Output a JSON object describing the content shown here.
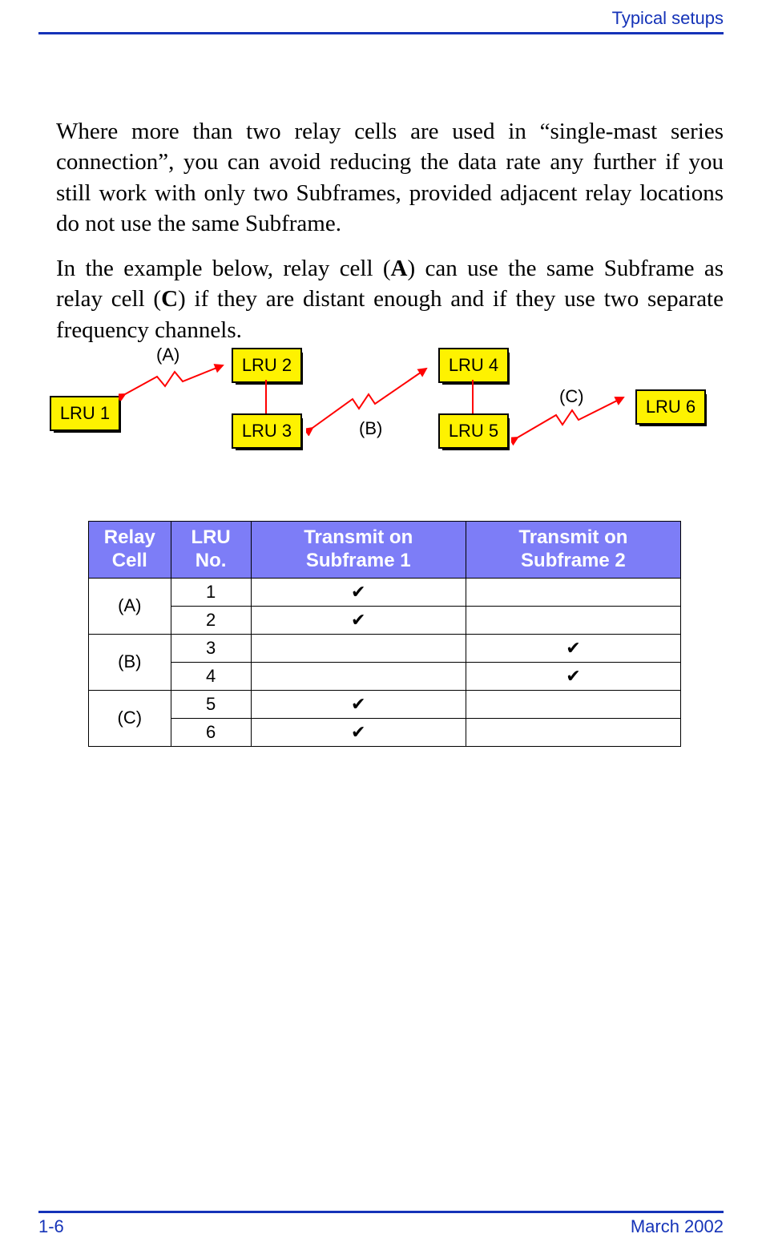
{
  "header": {
    "title": "Typical setups"
  },
  "body": {
    "para1": "Where more than two relay cells are used in “single-mast series connection”, you can avoid reducing the data rate any further if you still work with only two Subframes, provided adjacent relay locations do not use the same Subframe.",
    "p2_a": "In the example below, relay cell (",
    "p2_A": "A",
    "p2_b": ") can use the same Subframe as relay cell (",
    "p2_C": "C",
    "p2_c": ") if they are distant enough and if they use two separate frequency channels."
  },
  "diagram": {
    "lru": {
      "l1": "LRU 1",
      "l2": "LRU 2",
      "l3": "LRU 3",
      "l4": "LRU 4",
      "l5": "LRU 5",
      "l6": "LRU 6"
    },
    "cell": {
      "a": "(A)",
      "b": "(B)",
      "c": "(C)"
    }
  },
  "table": {
    "head": {
      "relay": "Relay Cell",
      "lru": "LRU No.",
      "sf1": "Transmit on Subframe 1",
      "sf2": "Transmit on Subframe 2"
    },
    "tick": "✔",
    "rows": [
      {
        "cell": "(A)",
        "lru": "1",
        "sf1": true,
        "sf2": false
      },
      {
        "cell": "",
        "lru": "2",
        "sf1": true,
        "sf2": false
      },
      {
        "cell": "(B)",
        "lru": "3",
        "sf1": false,
        "sf2": true
      },
      {
        "cell": "",
        "lru": "4",
        "sf1": false,
        "sf2": true
      },
      {
        "cell": "(C)",
        "lru": "5",
        "sf1": true,
        "sf2": false
      },
      {
        "cell": "",
        "lru": "6",
        "sf1": true,
        "sf2": false
      }
    ]
  },
  "footer": {
    "page": "1-6",
    "date": "March 2002"
  }
}
